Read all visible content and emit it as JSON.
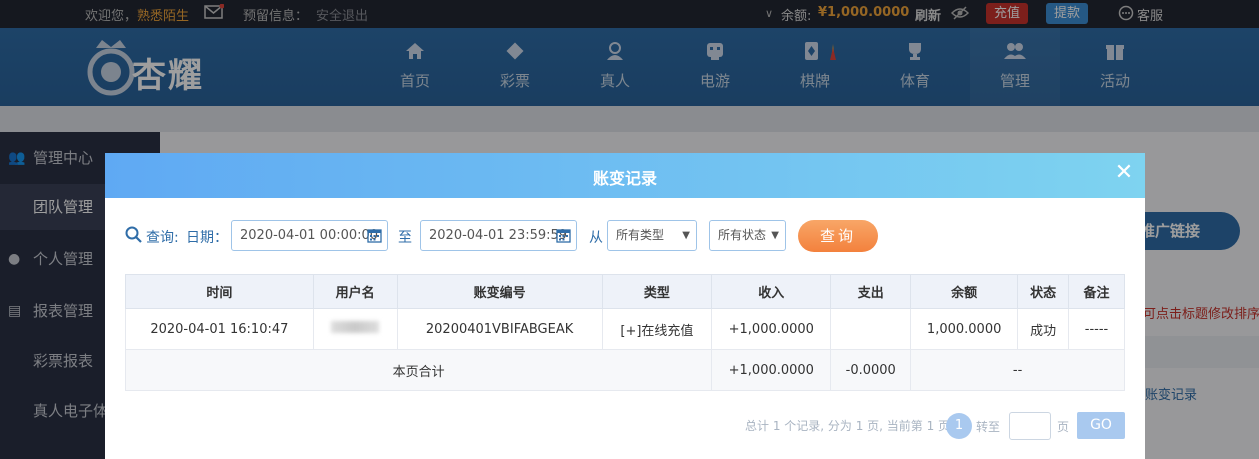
{
  "topbar": {
    "welcome": "欢迎您，",
    "username": "熟悉陌生",
    "reserve_label": "预留信息：",
    "logout": "安全退出",
    "balance_label": "余额:",
    "balance_value": "¥1,000.0000",
    "refresh": "刷新",
    "deposit": "充值",
    "withdraw": "提款",
    "support": "客服"
  },
  "header": {
    "logo_text": "杏耀",
    "nav": [
      {
        "label": "首页",
        "icon": "home-icon"
      },
      {
        "label": "彩票",
        "icon": "lottery-icon"
      },
      {
        "label": "真人",
        "icon": "live-icon"
      },
      {
        "label": "电游",
        "icon": "game-icon"
      },
      {
        "label": "棋牌",
        "icon": "cards-icon"
      },
      {
        "label": "体育",
        "icon": "trophy-icon"
      },
      {
        "label": "管理",
        "icon": "users-icon"
      },
      {
        "label": "活动",
        "icon": "gift-icon"
      }
    ]
  },
  "sidebar": {
    "items": [
      {
        "label": "管理中心"
      },
      {
        "label": "团队管理"
      },
      {
        "label": "个人管理"
      },
      {
        "label": "报表管理"
      },
      {
        "label": "彩票报表"
      },
      {
        "label": "真人电子体"
      }
    ]
  },
  "background": {
    "promo": "推广链接",
    "red_hint": "可点击标题修改排序",
    "link": "账变记录"
  },
  "modal": {
    "title": "账变记录",
    "query_label": "查询:",
    "date_label": "日期：",
    "start_date": "2020-04-01 00:00:00",
    "to": "至",
    "end_date": "2020-04-01 23:59:59",
    "from": "从",
    "type_select": "所有类型",
    "status_select": "所有状态",
    "query_button": "查询",
    "columns": [
      "时间",
      "用户名",
      "账变编号",
      "类型",
      "收入",
      "支出",
      "余额",
      "状态",
      "备注"
    ],
    "rows": [
      {
        "time": "2020-04-01 16:10:47",
        "user": "",
        "serial": "20200401VBIFABGEAK",
        "type": "[+]在线充值",
        "income": "+1,000.0000",
        "expense": "",
        "balance": "1,000.0000",
        "status": "成功",
        "note": "-----"
      }
    ],
    "summary": {
      "label": "本页合计",
      "income": "+1,000.0000",
      "expense": "-0.0000",
      "rest": "--"
    },
    "pager": {
      "info": "总计 1 个记录, 分为 1 页, 当前第 1 页",
      "current": "1",
      "goto": "转至",
      "page": "页",
      "go": "GO"
    }
  },
  "colors": {
    "header_blue": "#2f6da8",
    "modal_head_start": "#5fa9f3",
    "modal_head_end": "#7ed3f0",
    "query_orange": "#f3813d",
    "income_green": "#3c9a3c",
    "deposit_red": "#c8322c",
    "withdraw_blue": "#3d8fd6"
  }
}
